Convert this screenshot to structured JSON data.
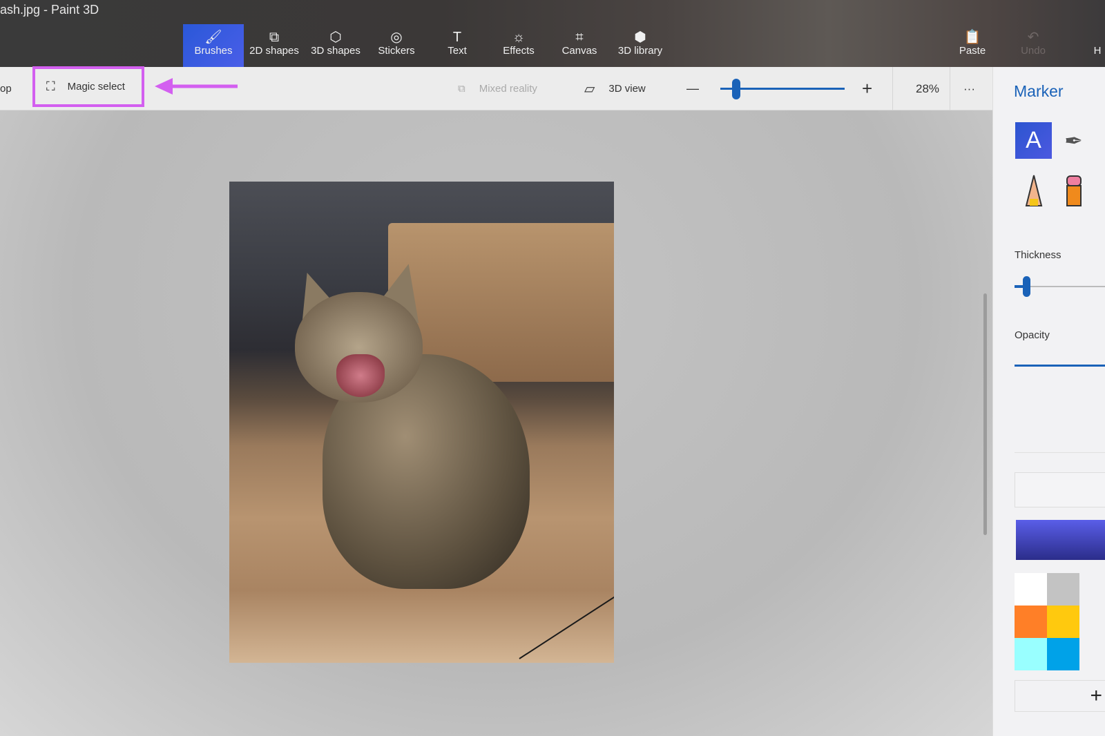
{
  "window": {
    "title": "ash.jpg - Paint 3D"
  },
  "ribbon": {
    "items": [
      {
        "label": "Brushes",
        "icon": "brush-icon",
        "glyph": "🖌",
        "active": true
      },
      {
        "label": "2D shapes",
        "icon": "2d-shapes-icon",
        "glyph": "⧉"
      },
      {
        "label": "3D shapes",
        "icon": "cube-icon",
        "glyph": "⬡"
      },
      {
        "label": "Stickers",
        "icon": "sticker-icon",
        "glyph": "◎"
      },
      {
        "label": "Text",
        "icon": "text-icon",
        "glyph": "T"
      },
      {
        "label": "Effects",
        "icon": "sun-icon",
        "glyph": "☼"
      },
      {
        "label": "Canvas",
        "icon": "canvas-crop-icon",
        "glyph": "⌗"
      },
      {
        "label": "3D library",
        "icon": "3d-library-icon",
        "glyph": "⬢"
      }
    ],
    "right": [
      {
        "label": "Paste",
        "icon": "paste-icon",
        "glyph": "📋"
      },
      {
        "label": "Undo",
        "icon": "undo-icon",
        "glyph": "↶",
        "disabled": true
      },
      {
        "label": "H"
      }
    ]
  },
  "toolbar": {
    "crop_partial": "op",
    "magic_select": "Magic select",
    "mixed_reality": "Mixed reality",
    "view_3d": "3D view",
    "zoom_minus": "—",
    "zoom_plus": "+",
    "zoom_value": "28%",
    "zoom_percent": 28,
    "more": "···"
  },
  "annotation": {
    "highlight_color": "#d35ff0"
  },
  "panel": {
    "title": "Marker",
    "thickness_label": "Thickness",
    "opacity_label": "Opacity",
    "thickness_level": 0.1,
    "opacity_level": 1.0,
    "current_color": "#4a4fd8",
    "add_color": "+",
    "swatches": [
      "#ffffff",
      "#c3c3c3",
      "#ff7f27",
      "#ffc90e",
      "#99ffff",
      "#00a2e8"
    ]
  },
  "accent": "#1a62b8"
}
